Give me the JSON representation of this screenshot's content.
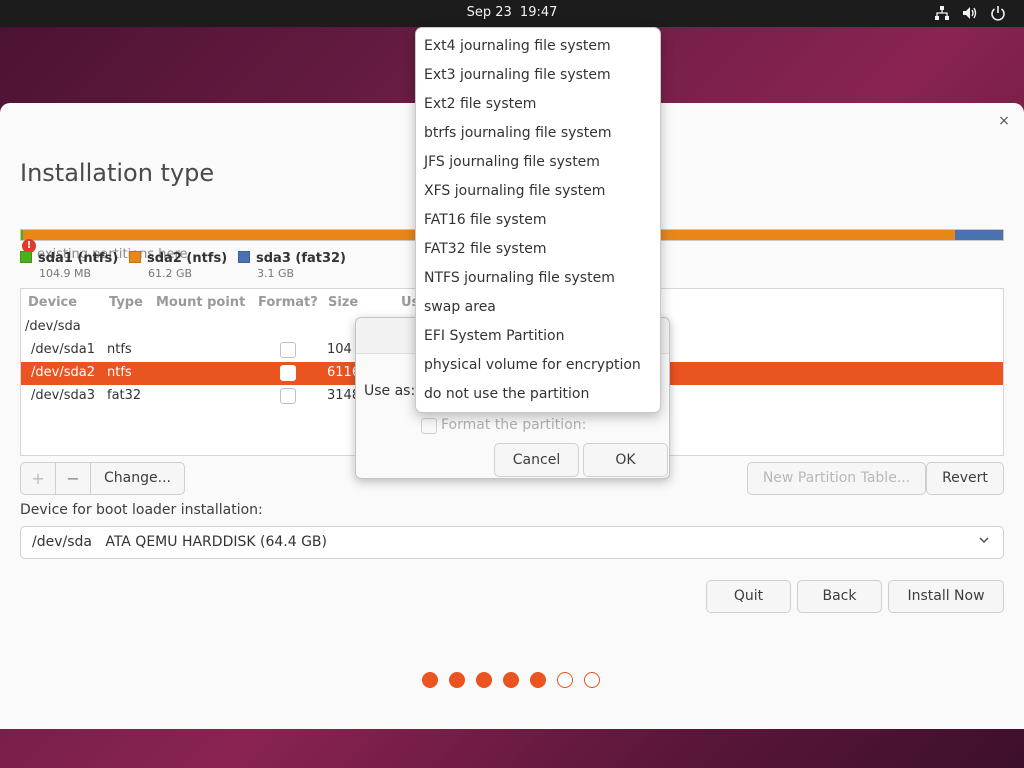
{
  "topbar": {
    "date": "Sep 23",
    "time": "19:47",
    "icons": [
      "network-icon",
      "volume-icon",
      "power-icon"
    ]
  },
  "window": {
    "title": "Installation type",
    "close_label": "×"
  },
  "partition_bar": {
    "warning_text": "existing partitions here",
    "legend": [
      {
        "name": "sda1 (ntfs)",
        "size": "104.9 MB",
        "color": "#4caf1f"
      },
      {
        "name": "sda2 (ntfs)",
        "size": "61.2 GB",
        "color": "#e8861a"
      },
      {
        "name": "sda3 (fat32)",
        "size": "3.1 GB",
        "color": "#4a72b0"
      }
    ]
  },
  "table": {
    "headers": [
      "Device",
      "Type",
      "Mount point",
      "Format?",
      "Size",
      "Us"
    ],
    "group": "/dev/sda",
    "rows": [
      {
        "device": "/dev/sda1",
        "type": "ntfs",
        "size": "104",
        "selected": false
      },
      {
        "device": "/dev/sda2",
        "type": "ntfs",
        "size": "6116",
        "selected": true
      },
      {
        "device": "/dev/sda3",
        "type": "fat32",
        "size": "3148",
        "selected": false
      }
    ]
  },
  "buttons": {
    "add": "+",
    "remove": "−",
    "change": "Change...",
    "new_partition_table": "New Partition Table...",
    "revert": "Revert",
    "quit": "Quit",
    "back": "Back",
    "install_now": "Install Now"
  },
  "bootloader": {
    "label": "Device for boot loader installation:",
    "value": "/dev/sda   ATA QEMU HARDDISK (64.4 GB)"
  },
  "progress": {
    "total": 7,
    "completed": 5,
    "accent": "#e95420"
  },
  "dialog": {
    "use_as_label": "Use as:",
    "format_label": "Format the partition:",
    "cancel": "Cancel",
    "ok": "OK"
  },
  "menu": {
    "items": [
      "Ext4 journaling file system",
      "Ext3 journaling file system",
      "Ext2 file system",
      "btrfs journaling file system",
      "JFS journaling file system",
      "XFS journaling file system",
      "FAT16 file system",
      "FAT32 file system",
      "NTFS journaling file system",
      "swap area",
      "EFI System Partition",
      "physical volume for encryption",
      "do not use the partition"
    ]
  }
}
